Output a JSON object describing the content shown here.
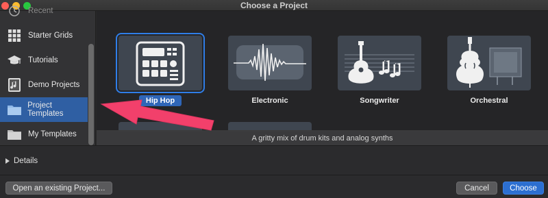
{
  "window": {
    "title": "Choose a Project"
  },
  "sidebar": {
    "items": [
      {
        "label": "Recent",
        "icon": "clock-icon",
        "partial": true
      },
      {
        "label": "Starter Grids",
        "icon": "grid-icon"
      },
      {
        "label": "Tutorials",
        "icon": "graduation-cap-icon"
      },
      {
        "label": "Demo Projects",
        "icon": "music-note-icon"
      },
      {
        "label": "Project Templates",
        "icon": "folder-icon",
        "selected": true
      },
      {
        "label": "My Templates",
        "icon": "folder-icon"
      }
    ]
  },
  "templates": [
    {
      "label": "Hip Hop",
      "icon": "drum-machine-icon",
      "selected": true
    },
    {
      "label": "Electronic",
      "icon": "waveform-icon"
    },
    {
      "label": "Songwriter",
      "icon": "acoustic-guitar-icon"
    },
    {
      "label": "Orchestral",
      "icon": "violin-icon"
    }
  ],
  "description": "A gritty mix of drum kits and analog synths",
  "details": {
    "label": "Details"
  },
  "buttons": {
    "open_existing": "Open an existing Project...",
    "cancel": "Cancel",
    "choose": "Choose"
  },
  "colors": {
    "selection_blue": "#2f5fa3",
    "accent_blue": "#2c6fd1",
    "annotation_arrow": "#f2406b"
  }
}
